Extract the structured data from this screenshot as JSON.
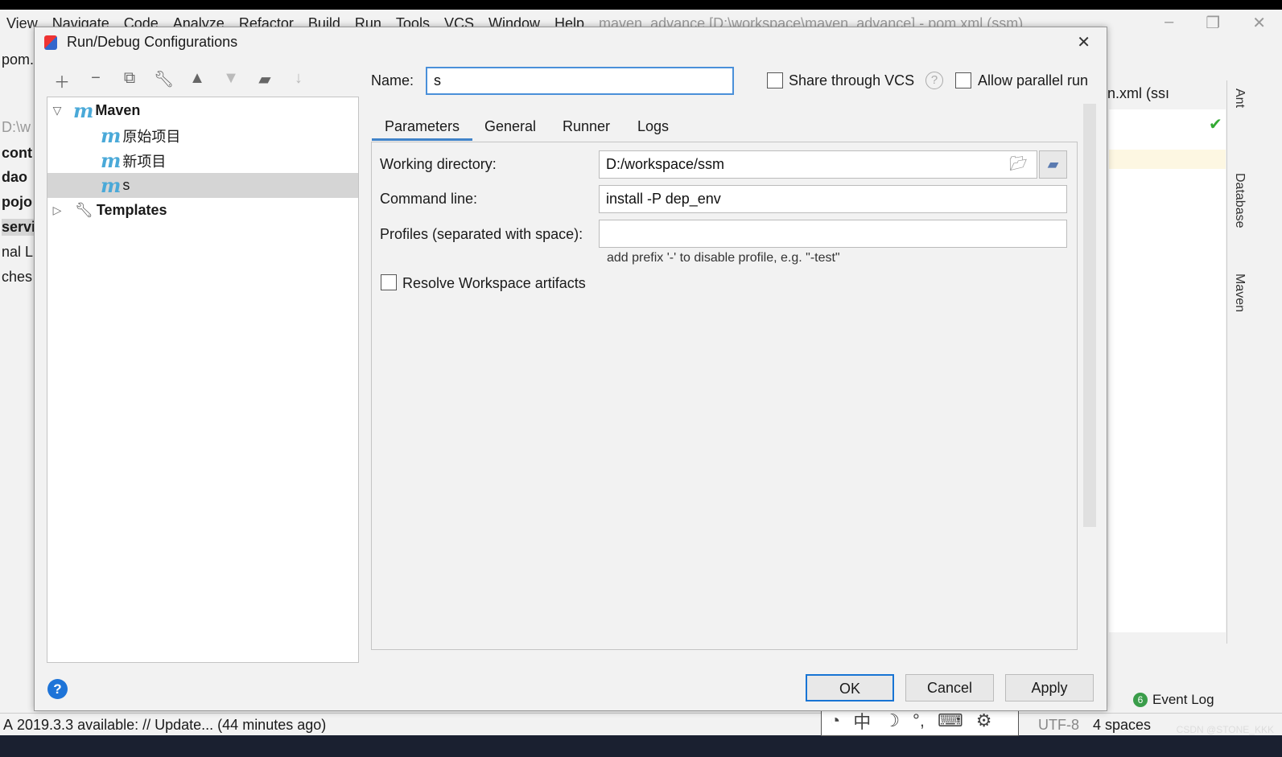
{
  "ide": {
    "menu": [
      "View",
      "Navigate",
      "Code",
      "Analyze",
      "Refactor",
      "Build",
      "Run",
      "Tools",
      "VCS",
      "Window",
      "Help"
    ],
    "window_title": "maven_advance [D:\\workspace\\maven_advance] - pom.xml (ssm)",
    "left_labels": [
      "pom.x",
      "D:\\w",
      "cont",
      "dao",
      "pojo",
      "servi",
      "nal L",
      "ches"
    ],
    "editor_tab": "n.xml (ssı",
    "side_tabs": [
      "Ant",
      "Database",
      "Maven"
    ],
    "event_log": {
      "count": "6",
      "label": "Event Log"
    },
    "status_text": "А 2019.3.3 available: // Update... (44 minutes ago)",
    "status_right": [
      "UTF-8",
      "4 spaces"
    ],
    "ime": [
      "中",
      "☽",
      "°,",
      "⌨",
      "⚙"
    ],
    "watermark": "CSDN @STONE_KKK"
  },
  "dialog": {
    "title": "Run/Debug Configurations",
    "toolbar_icons": [
      "add-icon",
      "remove-icon",
      "copy-icon",
      "wrench-icon",
      "move-up-icon",
      "move-down-icon",
      "new-folder-icon",
      "sort-icon"
    ],
    "tree": {
      "root": "Maven",
      "children": [
        "原始项目",
        "新项目",
        "s"
      ],
      "selected": "s",
      "templates": "Templates"
    },
    "name_label": "Name:",
    "name_value": "s",
    "share_vcs": {
      "label": "Share through VCS",
      "checked": false
    },
    "allow_parallel": {
      "label": "Allow parallel run",
      "checked": false
    },
    "tabs": [
      "Parameters",
      "General",
      "Runner",
      "Logs"
    ],
    "active_tab": "Parameters",
    "params": {
      "working_dir_label": "Working directory:",
      "working_dir_value": "D:/workspace/ssm",
      "command_label": "Command line:",
      "command_value": "install -P dep_env",
      "profiles_label": "Profiles (separated with space):",
      "profiles_value": "",
      "profiles_hint": "add prefix '-' to disable profile, e.g. \"-test\"",
      "resolve_label": "Resolve Workspace artifacts",
      "resolve_checked": false
    },
    "buttons": {
      "ok": "OK",
      "cancel": "Cancel",
      "apply": "Apply"
    },
    "accent": "#1874d4"
  }
}
